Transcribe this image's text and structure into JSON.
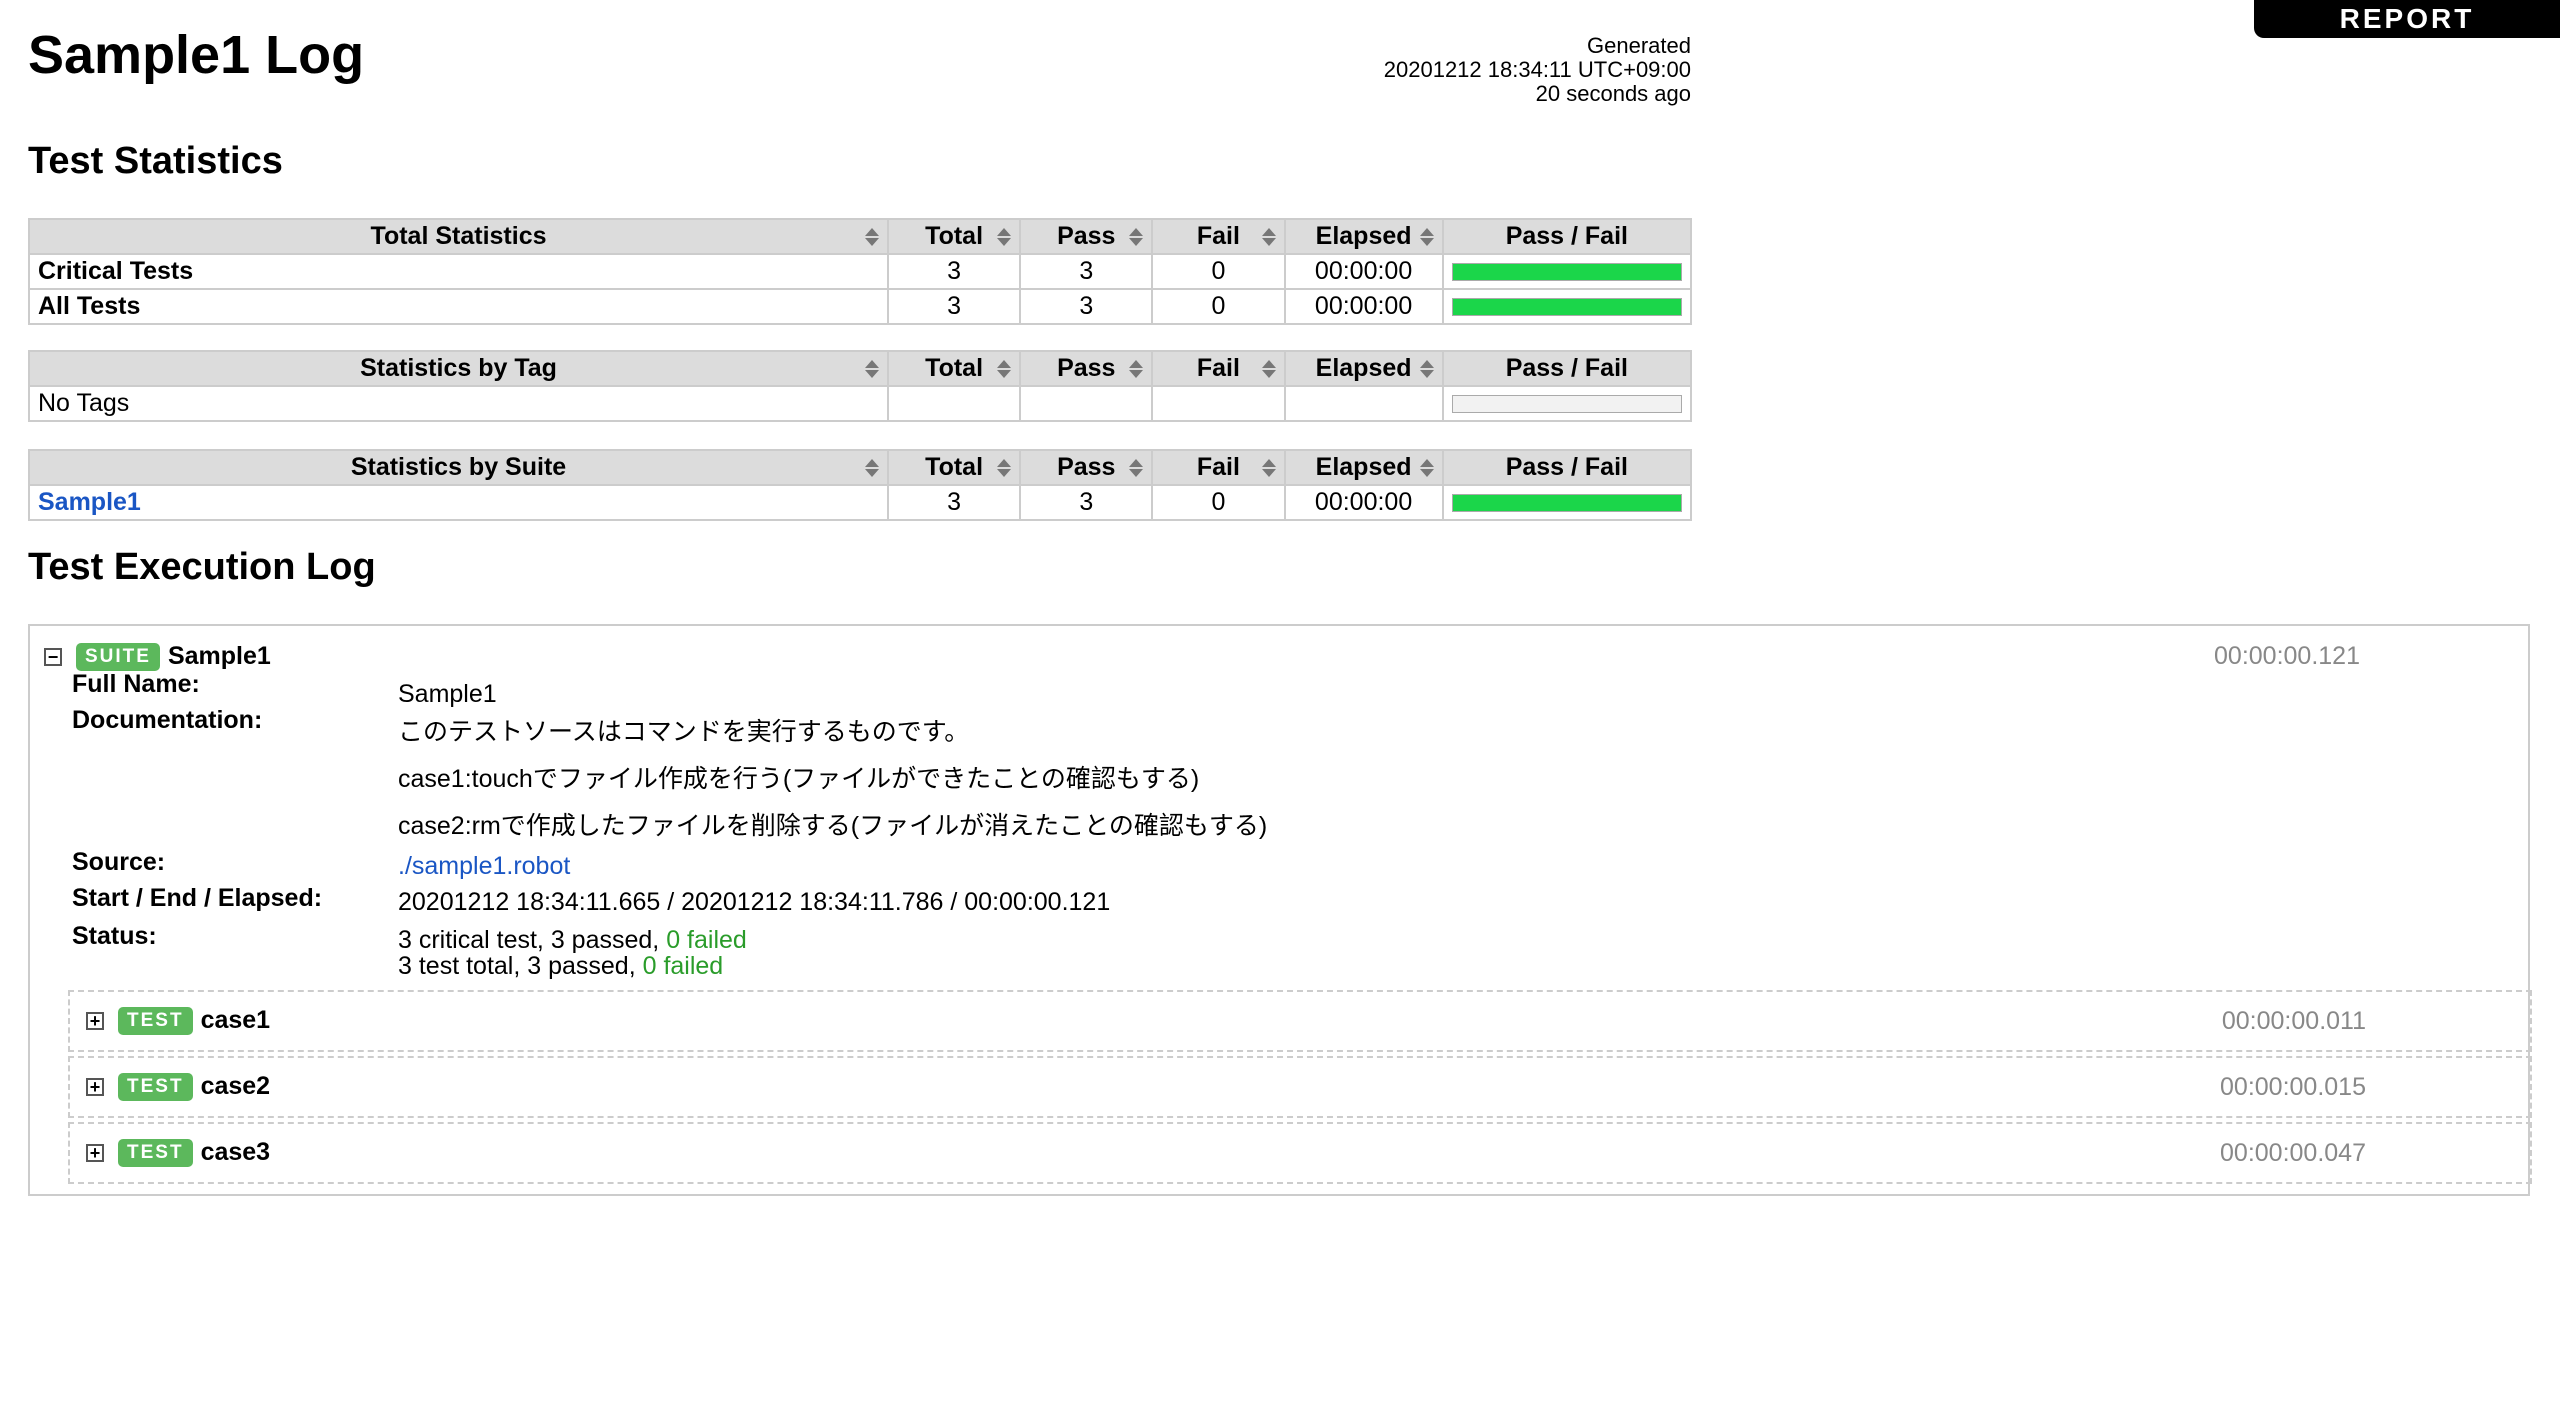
{
  "report_link": "REPORT",
  "title": "Sample1 Log",
  "generated": {
    "label": "Generated",
    "datetime": "20201212 18:34:11 UTC+09:00",
    "ago": "20 seconds ago"
  },
  "sections": {
    "stats": "Test Statistics",
    "log": "Test Execution Log"
  },
  "columns": [
    "Total",
    "Pass",
    "Fail",
    "Elapsed",
    "Pass / Fail"
  ],
  "total_stats": {
    "header": "Total Statistics",
    "rows": [
      {
        "name": "Critical Tests",
        "total": "3",
        "pass": "3",
        "fail": "0",
        "elapsed": "00:00:00",
        "pass_ratio": 1.0
      },
      {
        "name": "All Tests",
        "total": "3",
        "pass": "3",
        "fail": "0",
        "elapsed": "00:00:00",
        "pass_ratio": 1.0
      }
    ]
  },
  "tag_stats": {
    "header": "Statistics by Tag",
    "rows": [
      {
        "name": "No Tags",
        "total": "",
        "pass": "",
        "fail": "",
        "elapsed": "",
        "pass_ratio": 0
      }
    ]
  },
  "suite_stats": {
    "header": "Statistics by Suite",
    "rows": [
      {
        "name": "Sample1",
        "total": "3",
        "pass": "3",
        "fail": "0",
        "elapsed": "00:00:00",
        "pass_ratio": 1.0
      }
    ]
  },
  "colors": {
    "pass": "#1bd64a",
    "label": "#5cb85c",
    "link": "#1a56c4"
  },
  "suite": {
    "toggle": "−",
    "label": "SUITE",
    "name": "Sample1",
    "elapsed": "00:00:00.121",
    "full_name_key": "Full Name:",
    "full_name": "Sample1",
    "documentation_key": "Documentation:",
    "documentation": [
      "このテストソースはコマンドを実行するものです。",
      "case1:touchでファイル作成を行う(ファイルができたことの確認もする)",
      "case2:rmで作成したファイルを削除する(ファイルが消えたことの確認もする)"
    ],
    "source_key": "Source:",
    "source": "./sample1.robot",
    "times_key": "Start / End / Elapsed:",
    "times": "20201212 18:34:11.665 / 20201212 18:34:11.786 / 00:00:00.121",
    "status_key": "Status:",
    "status_critical": "3 critical test, 3 passed, ",
    "status_critical_failed": "0 failed",
    "status_total": "3 test total, 3 passed, ",
    "status_total_failed": "0 failed"
  },
  "tests": [
    {
      "toggle": "+",
      "label": "TEST",
      "name": "case1",
      "elapsed": "00:00:00.011"
    },
    {
      "toggle": "+",
      "label": "TEST",
      "name": "case2",
      "elapsed": "00:00:00.015"
    },
    {
      "toggle": "+",
      "label": "TEST",
      "name": "case3",
      "elapsed": "00:00:00.047"
    }
  ]
}
